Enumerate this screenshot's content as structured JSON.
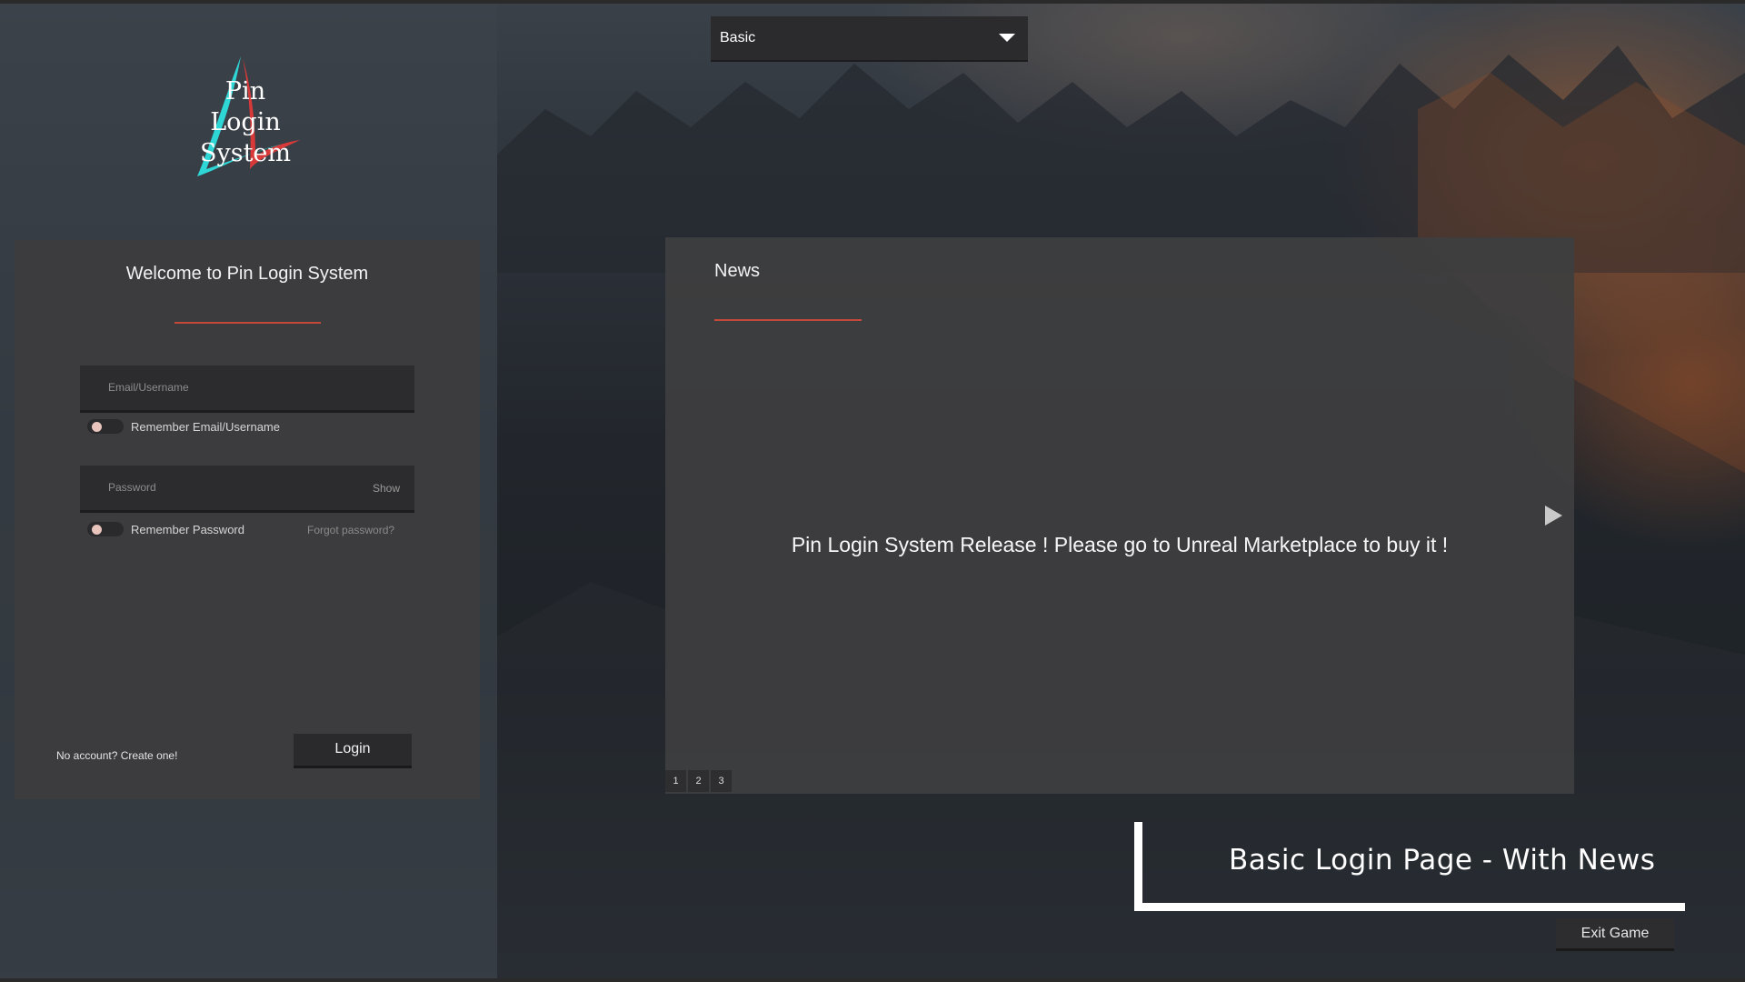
{
  "logo": {
    "text": "Pin\nLogin\nSystem"
  },
  "mode_dropdown": {
    "selected": "Basic"
  },
  "login": {
    "title": "Welcome to Pin Login System",
    "email_placeholder": "Email/Username",
    "remember_email_label": "Remember Email/Username",
    "password_placeholder": "Password",
    "show_label": "Show",
    "remember_password_label": "Remember Password",
    "forgot_label": "Forgot password?",
    "no_account_label": "No account? Create one!",
    "login_button": "Login"
  },
  "news": {
    "title": "News",
    "message": "Pin Login System Release ! Please go to Unreal Marketplace to buy it !",
    "pages": [
      "1",
      "2",
      "3"
    ]
  },
  "page_label": "Basic Login Page - With News",
  "exit_button": "Exit Game",
  "colors": {
    "accent": "#c4493a",
    "logo_cyan": "#2fd6d6",
    "logo_red": "#d83a3a"
  }
}
